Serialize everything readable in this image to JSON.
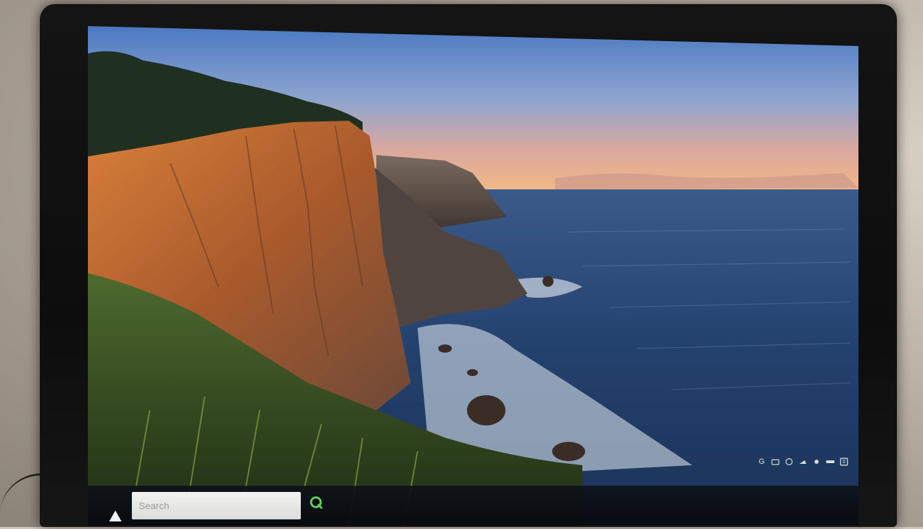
{
  "taskbar": {
    "search": {
      "placeholder": "Search",
      "value": ""
    },
    "start_icon": "triangle-up-icon",
    "app_icon": "refresh-green-icon",
    "accent": "#5fd35a",
    "tray_icons": [
      "notification-icon",
      "network-icon",
      "cloud-icon",
      "display-icon",
      "wifi-icon",
      "volume-icon",
      "battery-icon"
    ],
    "tray_first_label": "G"
  },
  "wallpaper": {
    "sky_top": "#4f7fc4",
    "sky_horizon": "#f3b98a",
    "sea": "#2c4a7a",
    "cliff": "#c97a3e"
  }
}
